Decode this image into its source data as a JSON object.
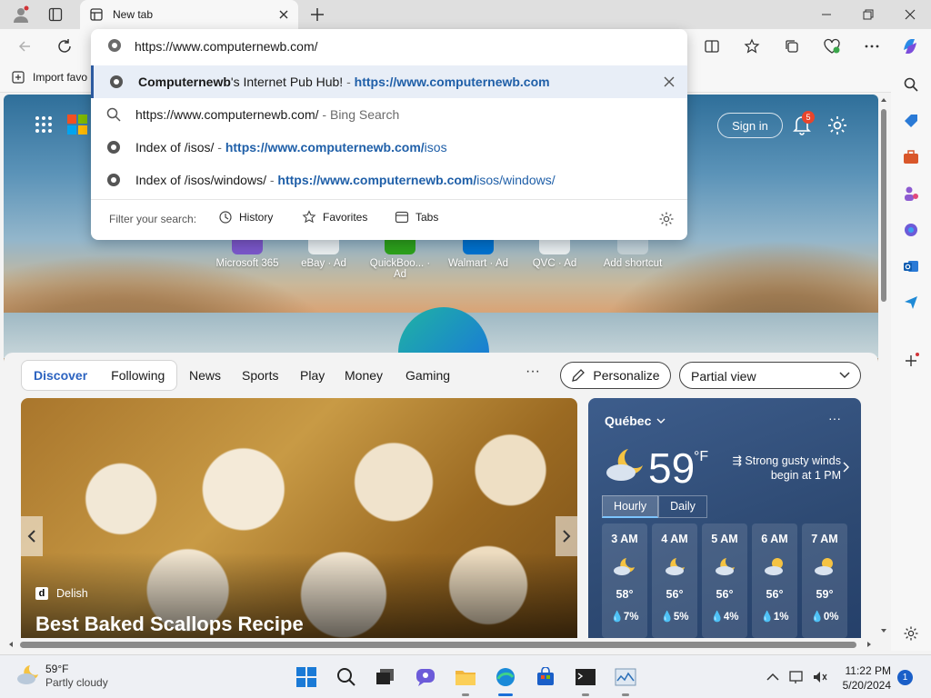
{
  "browser": {
    "tab_title": "New tab",
    "favorites_bar_import": "Import favo",
    "address_value_main": "https://www.computernewb.com/",
    "address_value_rest": ""
  },
  "omnibox": {
    "suggestions": [
      {
        "bold": "Computernewb",
        "text": "'s Internet Pub Hub!",
        "sep": " - ",
        "url": "https://www.computernewb.com",
        "url_rest": ""
      },
      {
        "bold": "",
        "text": "https://www.computernewb.com/",
        "sep": " - ",
        "muted": "Bing Search"
      },
      {
        "bold": "",
        "text": "Index of /isos/",
        "sep": " - ",
        "url": "https://www.computernewb.com/",
        "url_rest": "isos"
      },
      {
        "bold": "",
        "text": "Index of /isos/windows/",
        "sep": " - ",
        "url": "https://www.computernewb.com/",
        "url_rest": "isos/windows/"
      }
    ],
    "filter_label": "Filter your search:",
    "filters": [
      "History",
      "Favorites",
      "Tabs"
    ]
  },
  "newtab": {
    "sign_in": "Sign in",
    "notification_count": "5",
    "tiles": [
      "Microsoft 365",
      "eBay · Ad",
      "QuickBoo... · Ad",
      "Walmart · Ad",
      "QVC · Ad",
      "Add shortcut"
    ]
  },
  "discover": {
    "segments": [
      "Discover",
      "Following"
    ],
    "nav": [
      "News",
      "Sports",
      "Play",
      "Money",
      "Gaming"
    ],
    "more": "···",
    "personalize": "Personalize",
    "view_select": "Partial view"
  },
  "feature": {
    "source": "Delish",
    "source_logo": "d",
    "headline": "Best Baked Scallops Recipe"
  },
  "weather": {
    "location": "Québec",
    "temp": "59",
    "unit": "°F",
    "alert": "Strong gusty winds begin at 1 PM",
    "tabs": [
      "Hourly",
      "Daily"
    ],
    "hours": [
      {
        "time": "3 AM",
        "temp": "58°",
        "precip": "7%",
        "icon": "partly-cloudy-night-icon"
      },
      {
        "time": "4 AM",
        "temp": "56°",
        "precip": "5%",
        "icon": "partly-cloudy-night-icon"
      },
      {
        "time": "5 AM",
        "temp": "56°",
        "precip": "4%",
        "icon": "partly-cloudy-night-icon"
      },
      {
        "time": "6 AM",
        "temp": "56°",
        "precip": "1%",
        "icon": "partly-cloudy-icon"
      },
      {
        "time": "7 AM",
        "temp": "59°",
        "precip": "0%",
        "icon": "partly-cloudy-icon"
      }
    ]
  },
  "taskbar": {
    "weather_temp": "59°F",
    "weather_desc": "Partly cloudy",
    "time": "11:22 PM",
    "date": "5/20/2024",
    "notifications": "1"
  },
  "colors": {
    "accent": "#2c63c0",
    "link": "#1f5fa8",
    "weather_bg": "#2e4a73"
  }
}
